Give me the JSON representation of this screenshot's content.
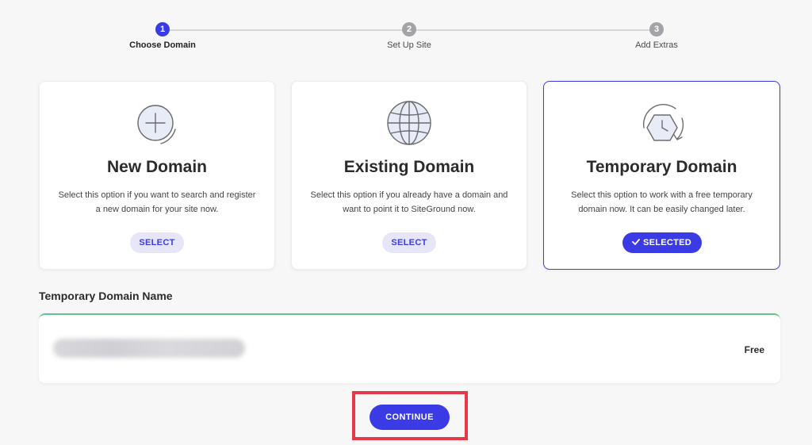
{
  "stepper": {
    "steps": [
      {
        "number": "1",
        "label": "Choose Domain"
      },
      {
        "number": "2",
        "label": "Set Up Site"
      },
      {
        "number": "3",
        "label": "Add Extras"
      }
    ],
    "active_step": 1
  },
  "cards": [
    {
      "icon": "plus-circle-icon",
      "title": "New Domain",
      "description": "Select this option if you want to search and register a new domain for your site now.",
      "button_label": "SELECT",
      "selected": false
    },
    {
      "icon": "globe-icon",
      "title": "Existing Domain",
      "description": "Select this option if you already have a domain and want to point it to SiteGround now.",
      "button_label": "SELECT",
      "selected": false
    },
    {
      "icon": "clock-icon",
      "title": "Temporary Domain",
      "description": "Select this option to work with a free temporary domain now. It can be easily changed later.",
      "button_label": "SELECTED",
      "selected": true
    }
  ],
  "domain_section": {
    "title": "Temporary Domain Name",
    "price_label": "Free"
  },
  "continue_label": "CONTINUE",
  "colors": {
    "accent": "#3b3be6",
    "success": "#5cc98a",
    "highlight": "#e53947"
  }
}
